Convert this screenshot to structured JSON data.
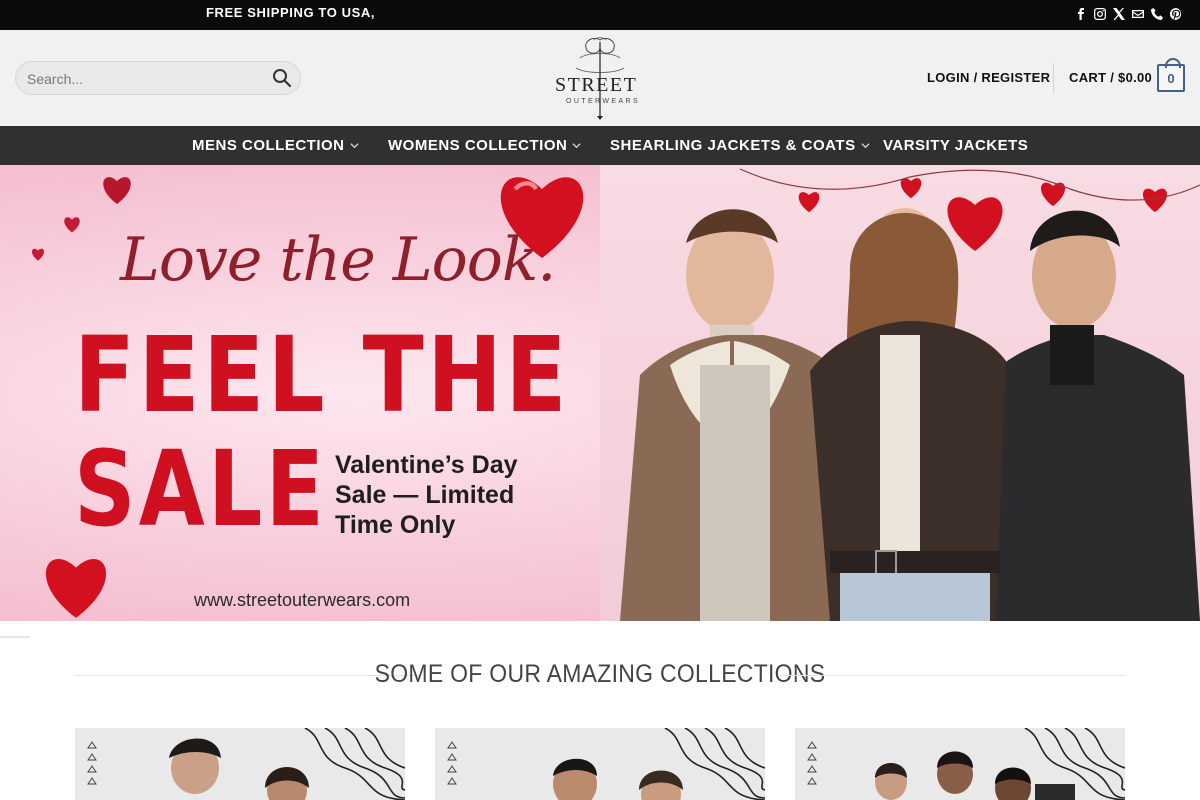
{
  "topbar": {
    "shipping_text": "FREE SHIPPING TO USA,",
    "social_icons": [
      "facebook-icon",
      "instagram-icon",
      "x-icon",
      "email-icon",
      "phone-icon",
      "pinterest-icon"
    ]
  },
  "header": {
    "search_placeholder": "Search...",
    "logo_text": "STREET",
    "logo_subtext": "OUTERWEARS",
    "login_label": "LOGIN / REGISTER",
    "cart_label": "CART / $0.00",
    "cart_count": "0"
  },
  "nav": {
    "items": [
      {
        "label": "MENS COLLECTION",
        "has_dropdown": true
      },
      {
        "label": "WOMENS COLLECTION",
        "has_dropdown": true
      },
      {
        "label": "SHEARLING JACKETS & COATS",
        "has_dropdown": true
      },
      {
        "label": "VARSITY JACKETS",
        "has_dropdown": false
      }
    ]
  },
  "hero": {
    "script_line": "Love the Look.",
    "headline_1": "FEEL THE",
    "headline_2": "SALE",
    "subline_1": "Valentine’s Day",
    "subline_2": "Sale — Limited",
    "subline_3": "Time Only",
    "url": "www.streetouterwears.com"
  },
  "collections": {
    "title": "SOME OF OUR AMAZING COLLECTIONS"
  },
  "colors": {
    "topbar": "#0b0b0b",
    "nav": "#303030",
    "accent": "#446084",
    "sale_red": "#cf1021"
  }
}
